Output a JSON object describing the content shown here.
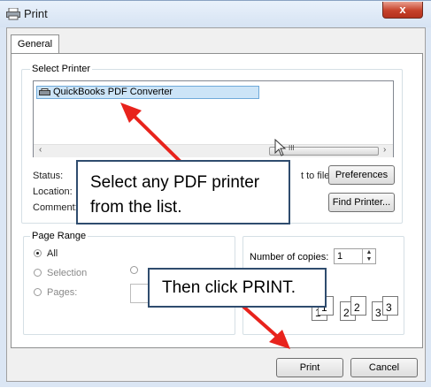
{
  "window": {
    "title": "Print",
    "close_glyph": "x"
  },
  "tabs": [
    {
      "label": "General"
    }
  ],
  "select_printer": {
    "group_label": "Select Printer",
    "selected_printer": "QuickBooks PDF Converter",
    "scroll_left": "‹",
    "scroll_right": "›",
    "scroll_grip": "III"
  },
  "printer_status": {
    "status_label": "Status:",
    "location_label": "Location:",
    "comment_label": "Comment:",
    "print_to_file_label": "t to file",
    "preferences_button": "Preferences",
    "find_printer_button": "Find Printer..."
  },
  "page_range": {
    "group_label": "Page Range",
    "all_label": "All",
    "selection_label": "Selection",
    "pages_label": "Pages:"
  },
  "copies": {
    "number_of_copies_label": "Number of copies:",
    "value": "1",
    "collate_pages": [
      "1",
      "1",
      "2",
      "2",
      "3",
      "3"
    ]
  },
  "annotations": {
    "callout_1": "Select any PDF printer from the list.",
    "callout_2": "Then click PRINT."
  },
  "footer": {
    "print_button": "Print",
    "cancel_button": "Cancel"
  },
  "colors": {
    "arrow": "#e8231c",
    "callout_border": "#2f4c6e",
    "selection_bg": "#cce4f7",
    "close_button": "#c6412a"
  }
}
